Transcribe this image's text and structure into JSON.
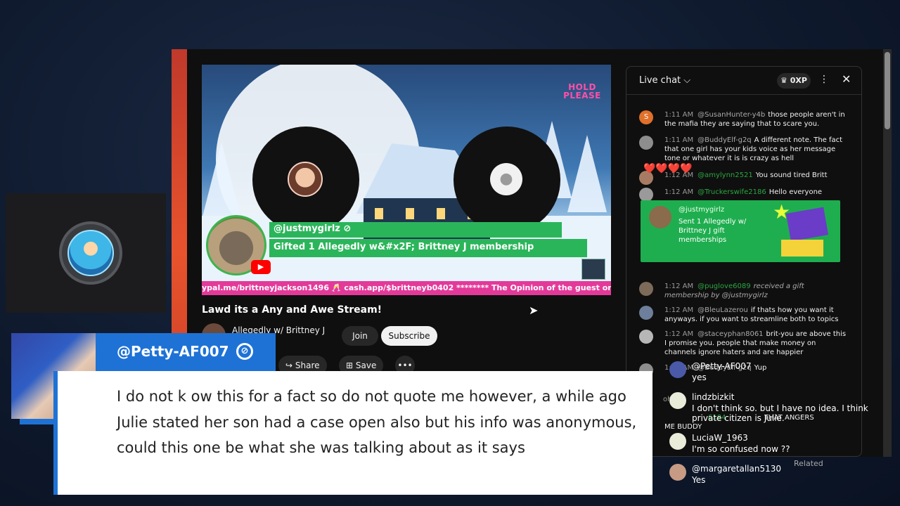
{
  "video": {
    "hold_badge": "HOLD PLEASE",
    "gift_user": "@justmygirlz ⊘",
    "gift_text": "Gifted 1 Allegedly w&#x2F; Brittney J membership",
    "ticker": "ypal.me/brittneyjackson1496 🥂 cash.app/$brittneyb0402 ******** The Opinion of the guest on this",
    "title": "Lawd its a Any and Awe Stream!",
    "channel_name": "Allegedly w/ Brittney J",
    "channel_subs": "rs",
    "join": "Join",
    "subscribe": "Subscribe",
    "share": "Share",
    "save": "Save",
    "more": "•••"
  },
  "chat": {
    "title": "Live chat ⌵",
    "xp": "♛ 0XP",
    "menu_icon": "⋮",
    "close_icon": "✕",
    "messages": [
      {
        "time": "1:11 AM",
        "user": "@SusanHunter-y4b",
        "text": "those people aren't in the mafia they are saying that to scare you.",
        "avatar_color": "#e0702a",
        "avatar_letter": "S",
        "member": false
      },
      {
        "time": "1:11 AM",
        "user": "@BuddyElf-g2q",
        "text": "A different note. The fact that one girl has your kids voice as her message tone or whatever it is is crazy as hell",
        "avatar_color": "#8d8d8d",
        "avatar_letter": "",
        "member": false
      },
      {
        "time": "1:12 AM",
        "user": "@amylynn2521",
        "text": "You sound tired Britt",
        "avatar_color": "#a77b63",
        "avatar_letter": "",
        "member": true
      },
      {
        "time": "1:12 AM",
        "user": "@Truckerswife2186",
        "text": "Hello everyone",
        "avatar_color": "#9a9a9a",
        "avatar_letter": "",
        "member": true
      },
      {
        "time": "1:12 AM",
        "user": "@puglove6089",
        "text": "received a gift membership by @justmygirlz",
        "avatar_color": "#7d6a58",
        "avatar_letter": "",
        "member": true
      },
      {
        "time": "1:12 AM",
        "user": "@BleuLazerou",
        "text": "if thats how you want it anyways. if you want to streamline both to topics",
        "avatar_color": "#6d7f9a",
        "avatar_letter": "",
        "member": false
      },
      {
        "time": "1:12 AM",
        "user": "@staceyphan8061",
        "text": "brit-you are above this I promise you. people that make money on channels ignore haters and are happier",
        "avatar_color": "#b7b7b7",
        "avatar_letter": "",
        "member": false
      },
      {
        "time": "1:12 AM",
        "user": "@BuddyElf-g2q",
        "text": "Yup",
        "avatar_color": "#8d8d8d",
        "avatar_letter": "",
        "member": false
      }
    ],
    "hearts": "❤️❤️❤️❤️",
    "gift_card": {
      "user": "@justmygirlz",
      "text": "Sent 1 Allegedly w/ Brittney J gift memberships"
    },
    "partial_bottom": "6184",
    "partial_bottom_text": "THAT ANGERS",
    "partial_me": "ME BUDDY",
    "related": "Related",
    "ohh": "ohh"
  },
  "comment": {
    "username": "@Petty-AF007",
    "verify_icon": "⊘",
    "yt_icon": "▶",
    "text": "I do not k ow this for a fact so do not quote me however, a while ago Julie stated her son had a case open also but his info was anonymous, could this one be what she was talking about as it says"
  },
  "feed": [
    {
      "user": "@Petty-AF007",
      "text": "yes",
      "avatar_color": "#4a5aa8"
    },
    {
      "user": "lindzbizkit",
      "text": "I don't think so. but I have no idea. I think private citizen is Julie.",
      "avatar_color": "#e9ecd9"
    },
    {
      "user": "LuciaW_1963",
      "text": "I'm so confused now ??",
      "avatar_color": "#e9ecd9"
    },
    {
      "user": "@margaretallan5130",
      "text": "Yes",
      "avatar_color": "#c79a84"
    }
  ],
  "colors": {
    "youtube_red": "#ff0000",
    "gift_green": "#2bb55a",
    "overlay_blue": "#1e72d6",
    "ticker_pink": "#e33a9a"
  }
}
